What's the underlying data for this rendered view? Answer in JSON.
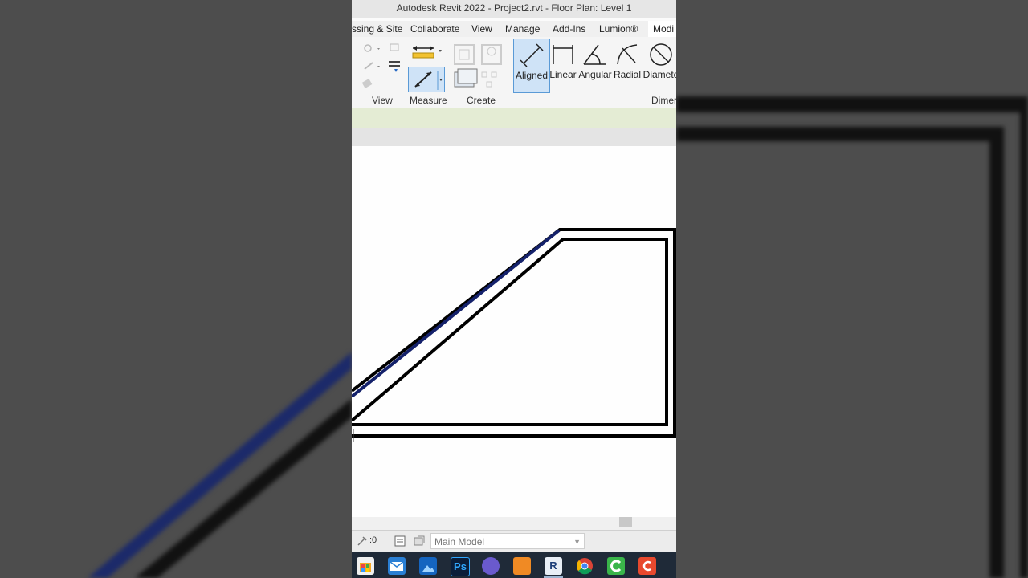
{
  "window": {
    "title": "Autodesk Revit 2022 - Project2.rvt - Floor Plan: Level 1"
  },
  "ribbon_tabs": [
    {
      "label": "ssing & Site"
    },
    {
      "label": "Collaborate"
    },
    {
      "label": "View"
    },
    {
      "label": "Manage"
    },
    {
      "label": "Add-Ins"
    },
    {
      "label": "Lumion®"
    },
    {
      "label": "Modi",
      "active": true
    }
  ],
  "ribbon": {
    "panels": {
      "view": "View",
      "measure": "Measure",
      "create": "Create",
      "dimension": "Dimer"
    },
    "dimension_tools": {
      "aligned": "Aligned",
      "linear": "Linear",
      "angular": "Angular",
      "radial": "Radial",
      "diameter": "Diamete"
    }
  },
  "status_bar": {
    "counter": ":0",
    "model_select": "Main Model"
  },
  "taskbar": {
    "icons": [
      "store-icon",
      "mail-icon",
      "photos-icon",
      "photoshop-icon",
      "browser-icon",
      "media-icon",
      "revit-icon",
      "chrome-icon",
      "camtasia-icon",
      "app-icon"
    ],
    "labels": {
      "photoshop": "Ps",
      "revit": "R"
    }
  },
  "colors": {
    "selection_blue": "#1a237e",
    "accent_select": "#cfe3f7",
    "taskbar": "#1f2a38",
    "option_bar": "#e4ecd4"
  }
}
